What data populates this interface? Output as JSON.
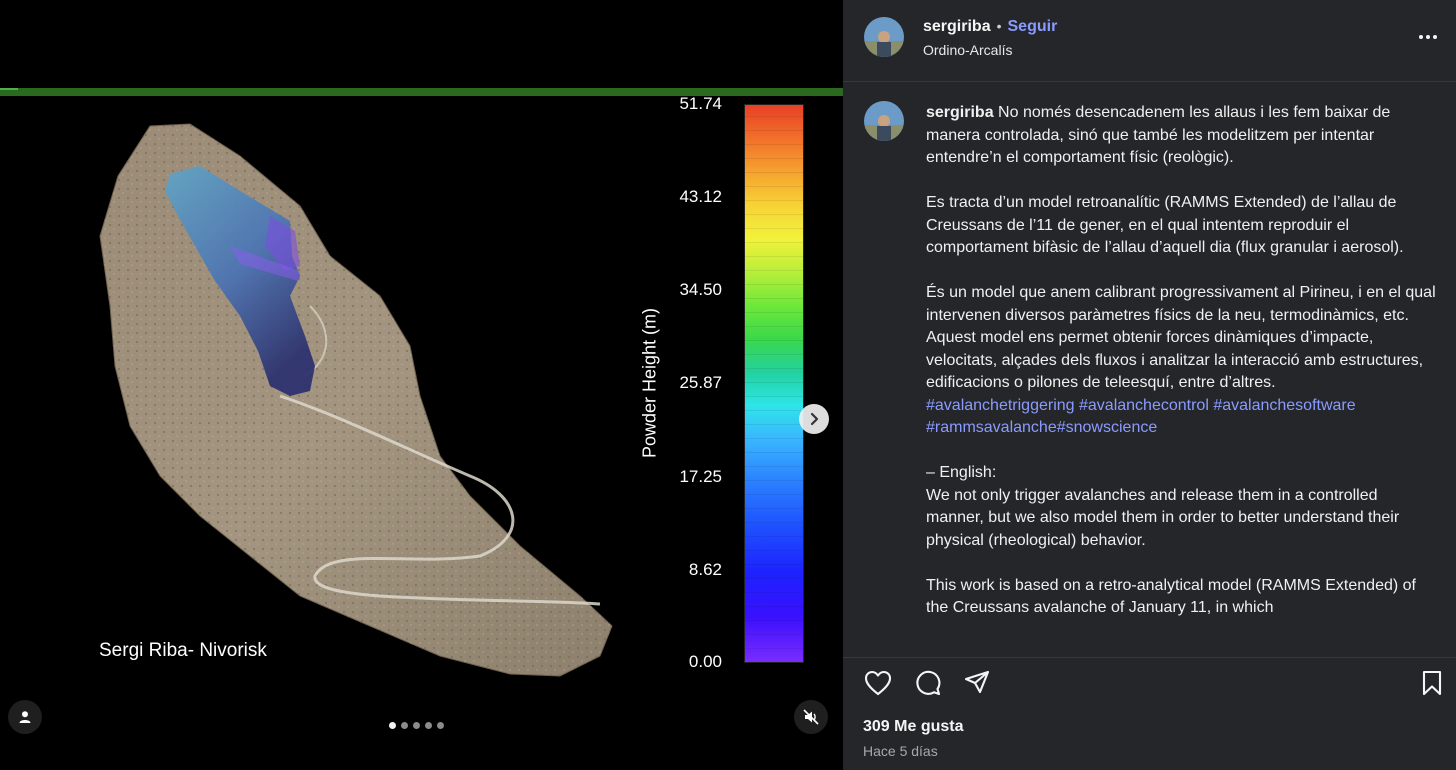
{
  "media": {
    "credit": "Sergi Riba- Nivorisk",
    "colorbar": {
      "title": "Powder Height (m)",
      "ticks": [
        "51.74",
        "43.12",
        "34.50",
        "25.87",
        "17.25",
        "8.62",
        "0.00"
      ]
    },
    "carousel": {
      "count": 5,
      "active": 0
    }
  },
  "post": {
    "username": "sergiriba",
    "follow_label": "Seguir",
    "bullet": "•",
    "location": "Ordino-Arcalís",
    "caption": {
      "p1": "No només desencadenem les allaus i les fem baixar de manera controlada, sinó que també les modelitzem per intentar entendre’n el comportament físic (reològic).",
      "p2": "Es tracta d’un model retroanalític (RAMMS Extended) de l’allau de Creussans de l’11 de gener, en el qual intentem reproduir el comportament bifàsic de l’allau d’aquell dia (flux granular i aerosol).",
      "p3": "És un model que anem calibrant progressivament al Pirineu, i en el qual intervenen diversos paràmetres físics de la neu, termodinàmics, etc. Aquest model ens permet obtenir forces dinàmiques d’impacte, velocitats, alçades dels fluxos i analitzar la interacció amb estructures, edificacions o pilones de teleesquí, entre d’altres.",
      "tags": [
        "#avalanchetriggering",
        "#avalanchecontrol",
        "#avalanchesoftware",
        "#rammsavalanche",
        "#snowscience"
      ],
      "english_label": "– English:",
      "p4": "We not only trigger avalanches and release them in a controlled manner, but we also model them in order to better understand their physical (rheological) behavior.",
      "p5": "This work is based on a retro-analytical model (RAMMS Extended) of the Creussans avalanche of January 11, in which"
    },
    "likes": "309 Me gusta",
    "time_ago": "Hace 5 días"
  }
}
